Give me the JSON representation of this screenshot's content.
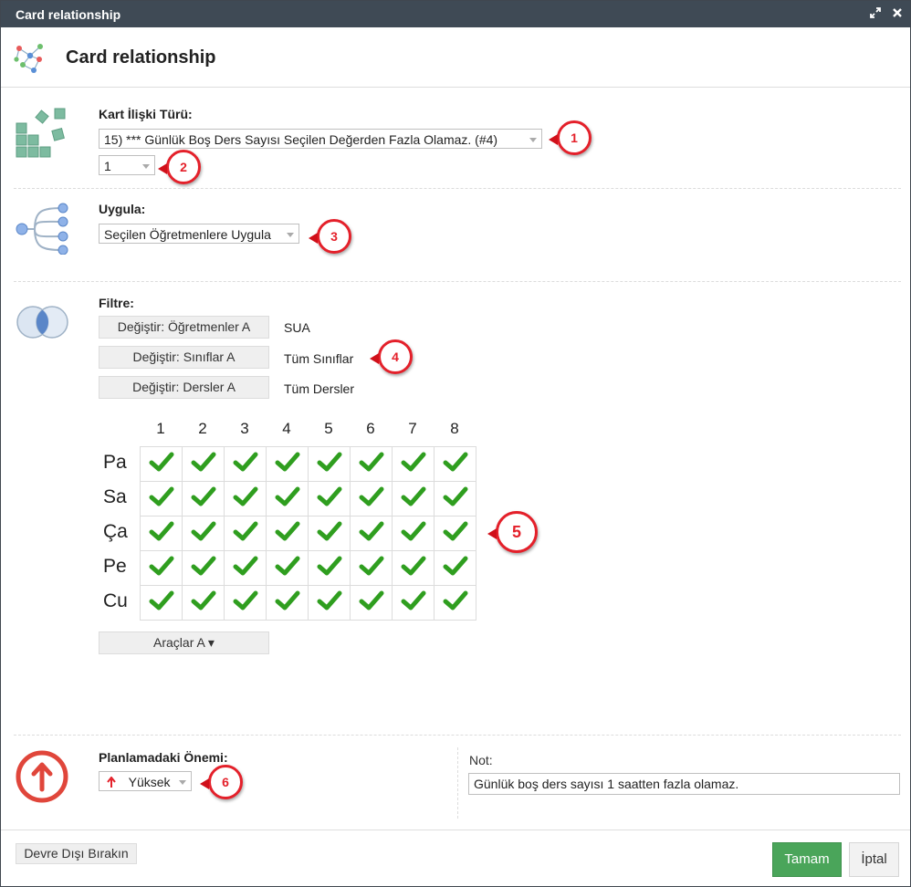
{
  "window": {
    "title": "Card relationship"
  },
  "header": {
    "title": "Card relationship"
  },
  "relation": {
    "label": "Kart İlişki Türü:",
    "type_value": "15) *** Günlük Boş Ders Sayısı Seçilen Değerden Fazla Olamaz. (#4)",
    "count_value": "1"
  },
  "apply": {
    "label": "Uygula:",
    "value": "Seçilen Öğretmenlere Uygula"
  },
  "filter": {
    "label": "Filtre:",
    "rows": [
      {
        "button": "Değiştir: Öğretmenler A",
        "value": "SUA"
      },
      {
        "button": "Değiştir: Sınıflar A",
        "value": "Tüm Sınıflar"
      },
      {
        "button": "Değiştir: Dersler A",
        "value": "Tüm Dersler"
      }
    ]
  },
  "grid": {
    "columns": [
      "1",
      "2",
      "3",
      "4",
      "5",
      "6",
      "7",
      "8"
    ],
    "rows": [
      "Pa",
      "Sa",
      "Ça",
      "Pe",
      "Cu"
    ],
    "check_color": "#2f9e1f"
  },
  "tools_button": "Araçlar A ▾",
  "importance": {
    "label": "Planlamadaki Önemi:",
    "value": "Yüksek",
    "color": "#e4202a"
  },
  "note": {
    "label": "Not:",
    "value": "Günlük boş ders sayısı 1 saatten fazla olamaz."
  },
  "footer": {
    "disable_button": "Devre Dışı Bırakın",
    "ok_button": "Tamam",
    "cancel_button": "İptal"
  },
  "callouts": [
    "1",
    "2",
    "3",
    "4",
    "5",
    "6"
  ]
}
